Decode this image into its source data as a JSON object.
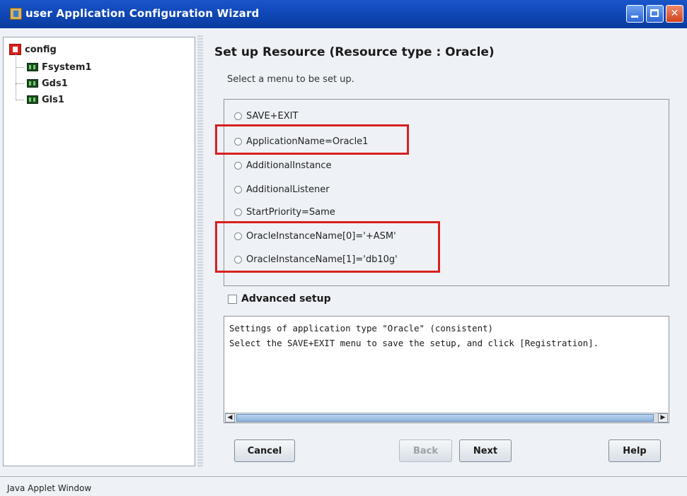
{
  "window": {
    "title": "user Application Configuration Wizard",
    "icons": [
      "app-icon",
      "minimize-icon",
      "maximize-icon",
      "close-icon"
    ]
  },
  "tree": {
    "root": "config",
    "children": [
      "Fsystem1",
      "Gds1",
      "Gls1"
    ]
  },
  "main": {
    "heading": "Set up Resource (Resource type : Oracle)",
    "subheading": "Select a menu to be set up.",
    "options": [
      "SAVE+EXIT",
      "ApplicationName=Oracle1",
      "AdditionalInstance",
      "AdditionalListener",
      "StartPriority=Same",
      "OracleInstanceName[0]='+ASM'",
      "OracleInstanceName[1]='db10g'"
    ],
    "highlight_color": "#d82020",
    "advanced_label": "Advanced setup",
    "description_lines": [
      "Settings of application type \"Oracle\" (consistent)",
      "Select the SAVE+EXIT menu to save the setup, and click [Registration]."
    ]
  },
  "buttons": {
    "cancel": "Cancel",
    "back": "Back",
    "next": "Next",
    "help": "Help"
  },
  "status": "Java Applet Window"
}
